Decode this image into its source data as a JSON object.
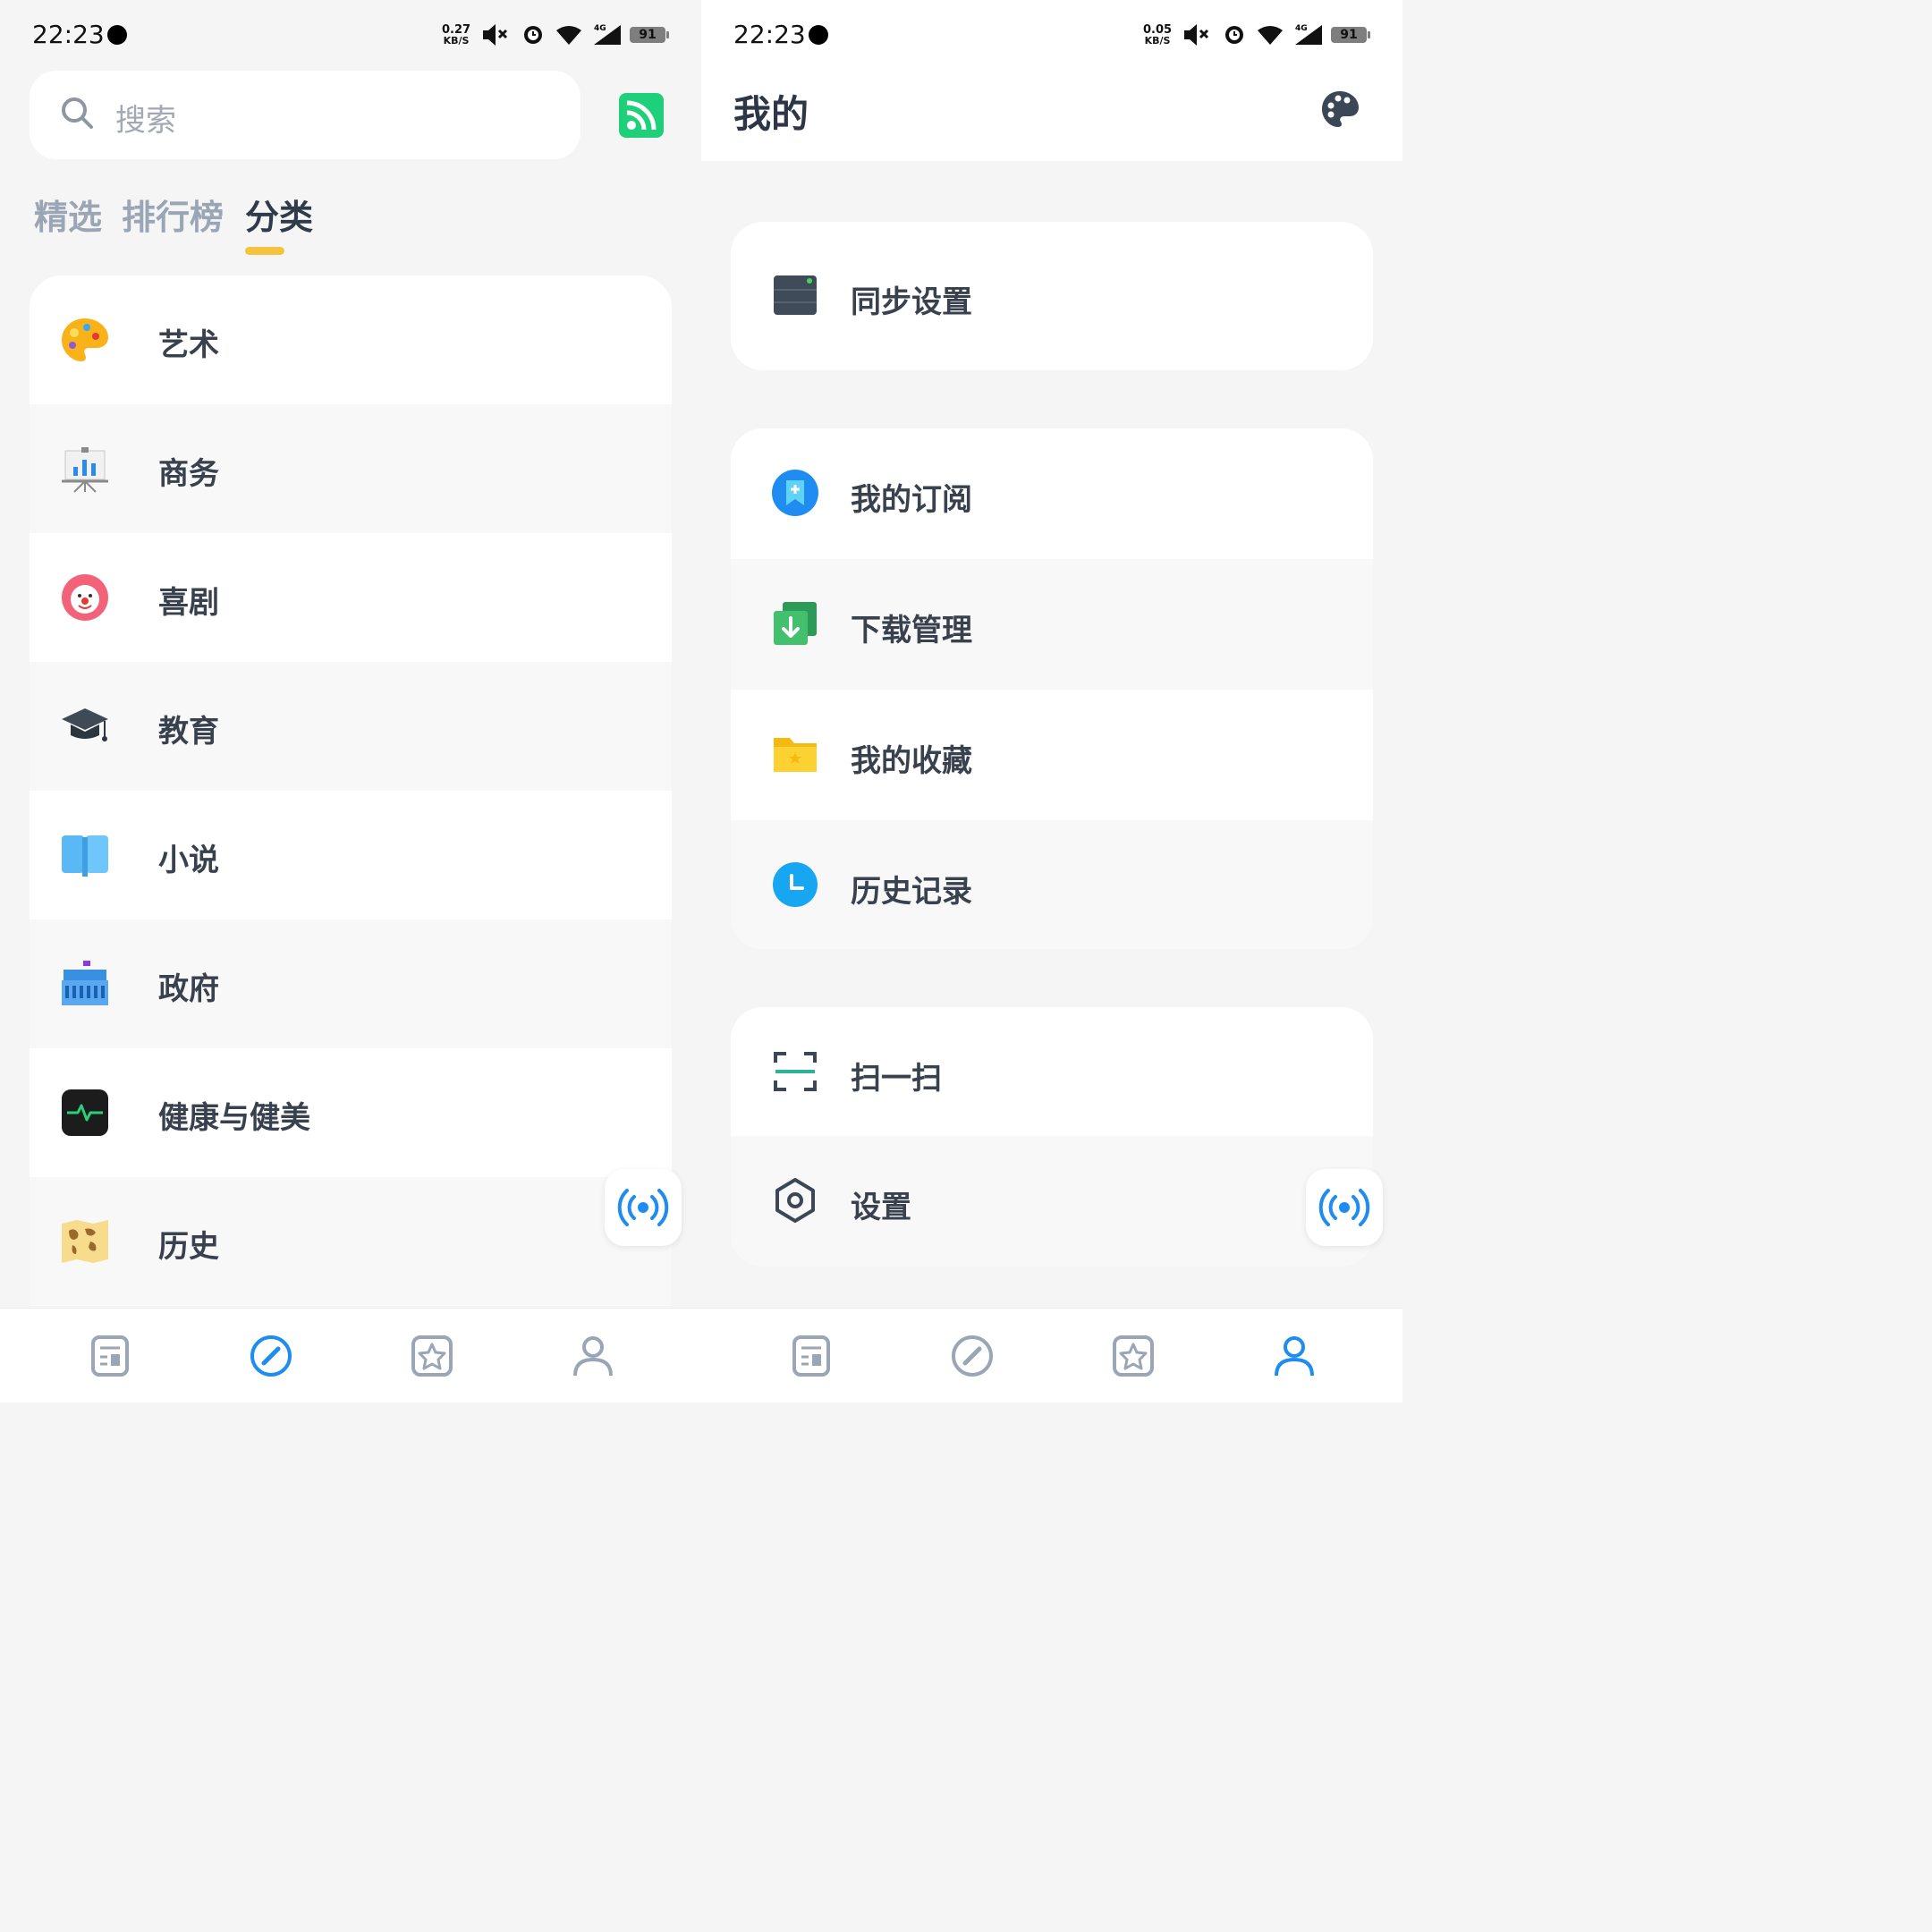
{
  "left": {
    "status": {
      "time": "22:23",
      "net_value": "0.27",
      "net_unit": "KB/S",
      "network_type": "4G",
      "battery": "91"
    },
    "search": {
      "placeholder": "搜索"
    },
    "tabs": [
      {
        "label": "精选"
      },
      {
        "label": "排行榜"
      },
      {
        "label": "分类",
        "active": true
      }
    ],
    "categories": [
      {
        "label": "艺术",
        "icon": "palette-icon"
      },
      {
        "label": "商务",
        "icon": "presentation-chart-icon"
      },
      {
        "label": "喜剧",
        "icon": "clown-icon"
      },
      {
        "label": "教育",
        "icon": "graduation-cap-icon"
      },
      {
        "label": "小说",
        "icon": "book-icon"
      },
      {
        "label": "政府",
        "icon": "government-building-icon"
      },
      {
        "label": "健康与健美",
        "icon": "heartbeat-icon"
      },
      {
        "label": "历史",
        "icon": "world-map-icon"
      }
    ],
    "active_nav": "discover"
  },
  "right": {
    "status": {
      "time": "22:23",
      "net_value": "0.05",
      "net_unit": "KB/S",
      "network_type": "4G",
      "battery": "91"
    },
    "title": "我的",
    "sync": {
      "label": "同步设置",
      "icon": "server-icon"
    },
    "menu": [
      {
        "label": "我的订阅",
        "icon": "subscription-icon"
      },
      {
        "label": "下载管理",
        "icon": "download-icon"
      },
      {
        "label": "我的收藏",
        "icon": "favorites-folder-icon"
      },
      {
        "label": "历史记录",
        "icon": "clock-icon"
      }
    ],
    "tools": [
      {
        "label": "扫一扫",
        "icon": "scan-icon"
      },
      {
        "label": "设置",
        "icon": "settings-hexagon-icon"
      }
    ],
    "active_nav": "profile"
  },
  "colors": {
    "accent": "#1e8cf0",
    "tab_underline": "#f6c340",
    "rss": "#1fd07a",
    "nav_inactive": "#9aa5b5"
  }
}
